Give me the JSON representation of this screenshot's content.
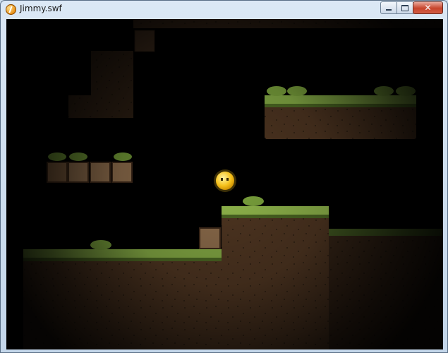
{
  "window": {
    "title": "Jimmy.swf",
    "app_icon": "flash-player-icon",
    "controls": {
      "minimize_icon": "minimize-icon",
      "maximize_icon": "maximize-icon",
      "close_icon": "close-icon",
      "close_glyph": "✕"
    }
  },
  "game": {
    "character": "jimmy-yellow-blob",
    "tile_colors": {
      "dirt": "#5a3d26",
      "dirt_dark": "#3b2718",
      "grass_top": "#8fb54b",
      "grass_dark": "#5b7a2c",
      "crate": "#8a6a4a",
      "player": "#f6c21c"
    }
  }
}
